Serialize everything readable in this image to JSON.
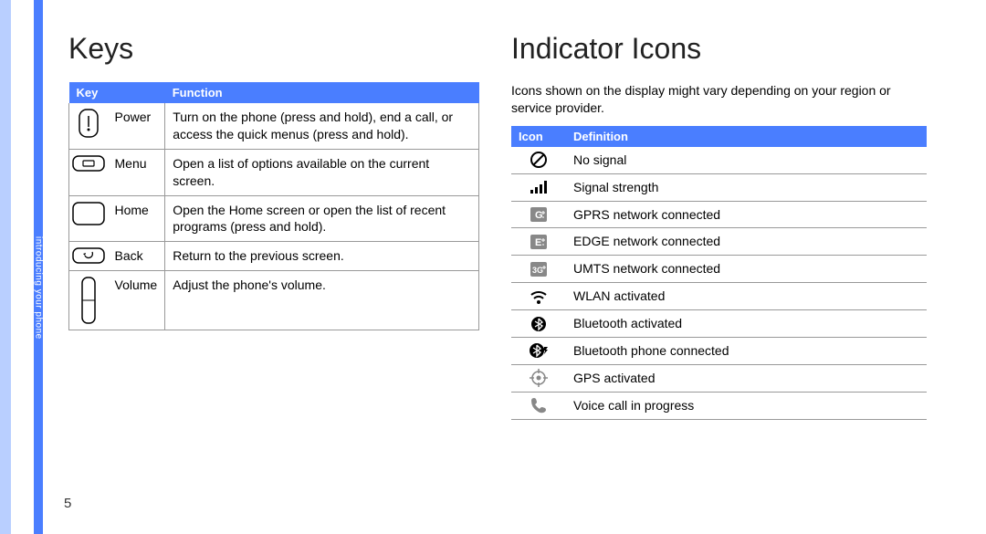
{
  "page_number": "5",
  "sidebar_label": "introducing your phone",
  "left": {
    "heading": "Keys",
    "table_headers": {
      "key": "Key",
      "function": "Function"
    },
    "rows": [
      {
        "icon": "power-key-icon",
        "name": "Power",
        "desc": "Turn on the phone (press and hold), end a call, or access the quick menus (press and hold)."
      },
      {
        "icon": "menu-key-icon",
        "name": "Menu",
        "desc": "Open a list of options available on the current screen."
      },
      {
        "icon": "home-key-icon",
        "name": "Home",
        "desc": "Open the Home screen or open the list of recent programs (press and hold)."
      },
      {
        "icon": "back-key-icon",
        "name": "Back",
        "desc": "Return to the previous screen."
      },
      {
        "icon": "volume-key-icon",
        "name": "Volume",
        "desc": "Adjust the phone's volume."
      }
    ]
  },
  "right": {
    "heading": "Indicator Icons",
    "intro": "Icons shown on the display might vary depending on your region or service provider.",
    "table_headers": {
      "icon": "Icon",
      "definition": "Definition"
    },
    "rows": [
      {
        "icon": "no-signal-icon",
        "def": "No signal"
      },
      {
        "icon": "signal-strength-icon",
        "def": "Signal strength"
      },
      {
        "icon": "gprs-icon",
        "def": "GPRS network connected"
      },
      {
        "icon": "edge-icon",
        "def": "EDGE network connected"
      },
      {
        "icon": "umts-icon",
        "def": "UMTS network connected"
      },
      {
        "icon": "wlan-icon",
        "def": "WLAN activated"
      },
      {
        "icon": "bluetooth-icon",
        "def": "Bluetooth activated"
      },
      {
        "icon": "bluetooth-connected-icon",
        "def": "Bluetooth phone connected"
      },
      {
        "icon": "gps-icon",
        "def": "GPS activated"
      },
      {
        "icon": "voice-call-icon",
        "def": "Voice call in progress"
      }
    ]
  }
}
